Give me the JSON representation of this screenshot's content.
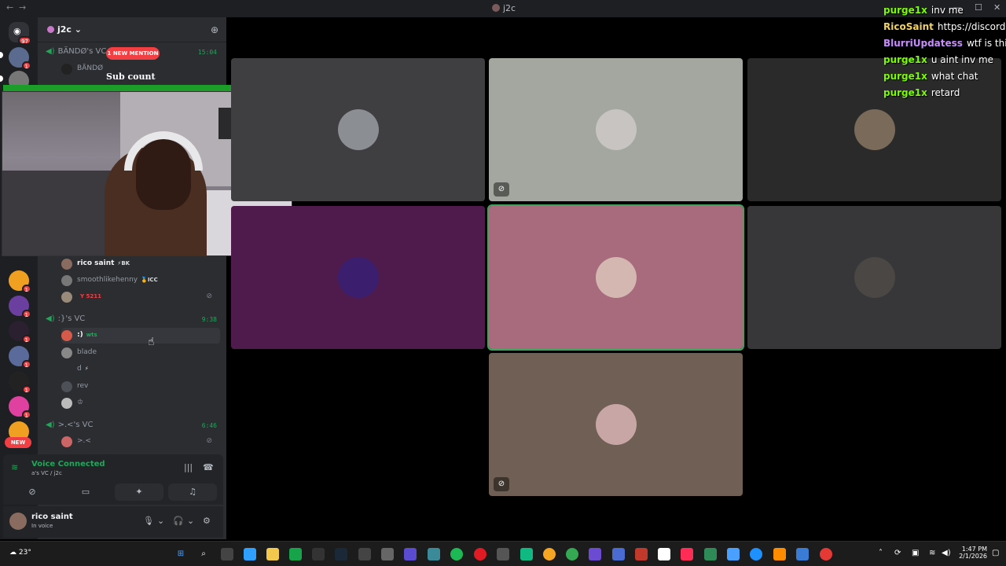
{
  "window": {
    "title": "j2c",
    "back": "←",
    "forward": "→"
  },
  "guilds": {
    "home_badge": "97",
    "new_label": "NEW",
    "badges": [
      "1",
      "1",
      "1",
      "1",
      "1",
      "1",
      "1",
      "1",
      "1",
      "1",
      "1"
    ]
  },
  "server": {
    "name": "j2c",
    "chevron": "⌄",
    "invite_icon": "person-add-icon"
  },
  "overlay": {
    "new_mention": "1 NEW MENTION",
    "sub_count": "Sub count"
  },
  "voice_channels": [
    {
      "name": "BÄNDØ's VC",
      "time": "15:04",
      "members": [
        {
          "name": "BÄNDØ",
          "tag": ""
        }
      ]
    },
    {
      "name": "",
      "time": "",
      "members": [
        {
          "name": "rico saint",
          "tag": "⚡BK"
        },
        {
          "name": "smoothlikehenny",
          "tag": "🏅ICC"
        },
        {
          "name": "",
          "tag": "Y 5211"
        }
      ]
    },
    {
      "name": ":}'s VC",
      "time": "9:38",
      "members": [
        {
          "name": ":)",
          "tag": "wts"
        },
        {
          "name": "blade",
          "tag": ""
        },
        {
          "name": "d",
          "tag": "⚡"
        },
        {
          "name": "rev",
          "tag": ""
        },
        {
          "name": "♔",
          "tag": ""
        }
      ]
    },
    {
      "name": ">.<'s VC",
      "time": "6:46",
      "members": [
        {
          "name": ">.<",
          "tag": ""
        }
      ]
    }
  ],
  "voice_panel": {
    "status": "Voice Connected",
    "location": "a's VC / j2c"
  },
  "user": {
    "name": "rico saint",
    "status": "In voice"
  },
  "chat": [
    {
      "user": "purge1x",
      "message": "inv me",
      "color": "#7cfc00"
    },
    {
      "user": "RicoSaint",
      "message": "https://discord.gg/l",
      "color": "#f0d264"
    },
    {
      "user": "BlurriUpdatess",
      "message": "wtf is this.",
      "color": "#c98cff"
    },
    {
      "user": "purge1x",
      "message": "u aint inv me",
      "color": "#7cfc00"
    },
    {
      "user": "purge1x",
      "message": "what chat",
      "color": "#7cfc00"
    },
    {
      "user": "purge1x",
      "message": "retard",
      "color": "#7cfc00"
    }
  ],
  "tiles": [
    {
      "bg": "#3f3e40",
      "avatar": "#8b8f94",
      "muted": false
    },
    {
      "bg": "#a3a79f",
      "avatar": "#c7c4c2",
      "muted": true
    },
    {
      "bg": "#2b2a2a",
      "avatar": "#7a6a5a",
      "muted": false
    },
    {
      "bg": "#4f1b4c",
      "avatar": "#3b1f6e",
      "muted": false
    },
    {
      "bg": "#a86b7e",
      "avatar": "#d4b7b0",
      "muted": false
    },
    {
      "bg": "#373639",
      "avatar": "#4a4744",
      "muted": false
    },
    {
      "bg": "#6f5f54",
      "avatar": "#c9a6a6",
      "muted": true
    }
  ],
  "taskbar": {
    "temp": "23°",
    "time": "1:47 PM",
    "date": "2/1/2026"
  }
}
